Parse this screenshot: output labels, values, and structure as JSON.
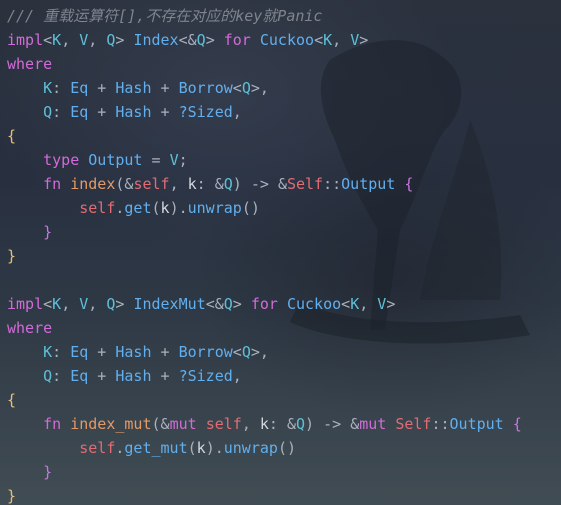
{
  "theme": {
    "background": "#2b313d",
    "colors": {
      "comment": "#7f848e",
      "keyword": "#d26bd8",
      "type": "#61afef",
      "generic": "#5ec0d8",
      "function": "#e39a66",
      "self": "#e06c75",
      "brace_outer": "#e5c07b",
      "brace_inner": "#c678dd"
    }
  },
  "editor": {
    "language": "rust",
    "lines": [
      [
        [
          "/// 重载运算符[],不存在对应的key就Panic",
          "comment"
        ]
      ],
      [
        [
          "impl",
          "kw"
        ],
        [
          "<",
          "op"
        ],
        [
          "K",
          "ty"
        ],
        [
          ", ",
          "punct"
        ],
        [
          "V",
          "ty"
        ],
        [
          ", ",
          "punct"
        ],
        [
          "Q",
          "ty"
        ],
        [
          "> ",
          "op"
        ],
        [
          "Index",
          "type"
        ],
        [
          "<",
          "op"
        ],
        [
          "&",
          "op"
        ],
        [
          "Q",
          "ty"
        ],
        [
          "> ",
          "op"
        ],
        [
          "for ",
          "kw"
        ],
        [
          "Cuckoo",
          "type"
        ],
        [
          "<",
          "op"
        ],
        [
          "K",
          "ty"
        ],
        [
          ", ",
          "punct"
        ],
        [
          "V",
          "ty"
        ],
        [
          ">",
          "op"
        ]
      ],
      [
        [
          "where",
          "kw"
        ]
      ],
      [
        [
          "    ",
          "plain"
        ],
        [
          "K",
          "ty"
        ],
        [
          ": ",
          "punct"
        ],
        [
          "Eq",
          "type"
        ],
        [
          " + ",
          "op"
        ],
        [
          "Hash",
          "type"
        ],
        [
          " + ",
          "op"
        ],
        [
          "Borrow",
          "type"
        ],
        [
          "<",
          "op"
        ],
        [
          "Q",
          "ty"
        ],
        [
          ">",
          "op"
        ],
        [
          ",",
          "punct"
        ]
      ],
      [
        [
          "    ",
          "plain"
        ],
        [
          "Q",
          "ty"
        ],
        [
          ": ",
          "punct"
        ],
        [
          "Eq",
          "type"
        ],
        [
          " + ",
          "op"
        ],
        [
          "Hash",
          "type"
        ],
        [
          " + ",
          "op"
        ],
        [
          "?Sized",
          "type"
        ],
        [
          ",",
          "punct"
        ]
      ],
      [
        [
          "{",
          "brace1"
        ]
      ],
      [
        [
          "    ",
          "plain"
        ],
        [
          "type ",
          "kw"
        ],
        [
          "Output",
          "type"
        ],
        [
          " = ",
          "op"
        ],
        [
          "V",
          "ty"
        ],
        [
          ";",
          "punct"
        ]
      ],
      [
        [
          "    ",
          "plain"
        ],
        [
          "fn ",
          "kw"
        ],
        [
          "index",
          "fn"
        ],
        [
          "(",
          "punct"
        ],
        [
          "&",
          "op"
        ],
        [
          "self",
          "self"
        ],
        [
          ", ",
          "punct"
        ],
        [
          "k",
          "ident"
        ],
        [
          ": ",
          "punct"
        ],
        [
          "&",
          "op"
        ],
        [
          "Q",
          "ty"
        ],
        [
          ") -> ",
          "op"
        ],
        [
          "&",
          "op"
        ],
        [
          "Self",
          "self"
        ],
        [
          "::",
          "punct"
        ],
        [
          "Output",
          "type"
        ],
        [
          " ",
          "plain"
        ],
        [
          "{",
          "brace2"
        ]
      ],
      [
        [
          "        ",
          "plain"
        ],
        [
          "self",
          "self"
        ],
        [
          ".",
          "punct"
        ],
        [
          "get",
          "method"
        ],
        [
          "(",
          "punct"
        ],
        [
          "k",
          "ident"
        ],
        [
          ")",
          "punct"
        ],
        [
          ".",
          "punct"
        ],
        [
          "unwrap",
          "method"
        ],
        [
          "()",
          "punct"
        ]
      ],
      [
        [
          "    ",
          "plain"
        ],
        [
          "}",
          "brace2"
        ]
      ],
      [
        [
          "}",
          "brace1"
        ]
      ],
      [
        [
          "",
          "plain"
        ]
      ],
      [
        [
          "impl",
          "kw"
        ],
        [
          "<",
          "op"
        ],
        [
          "K",
          "ty"
        ],
        [
          ", ",
          "punct"
        ],
        [
          "V",
          "ty"
        ],
        [
          ", ",
          "punct"
        ],
        [
          "Q",
          "ty"
        ],
        [
          "> ",
          "op"
        ],
        [
          "IndexMut",
          "type"
        ],
        [
          "<",
          "op"
        ],
        [
          "&",
          "op"
        ],
        [
          "Q",
          "ty"
        ],
        [
          "> ",
          "op"
        ],
        [
          "for ",
          "kw"
        ],
        [
          "Cuckoo",
          "type"
        ],
        [
          "<",
          "op"
        ],
        [
          "K",
          "ty"
        ],
        [
          ", ",
          "punct"
        ],
        [
          "V",
          "ty"
        ],
        [
          ">",
          "op"
        ]
      ],
      [
        [
          "where",
          "kw"
        ]
      ],
      [
        [
          "    ",
          "plain"
        ],
        [
          "K",
          "ty"
        ],
        [
          ": ",
          "punct"
        ],
        [
          "Eq",
          "type"
        ],
        [
          " + ",
          "op"
        ],
        [
          "Hash",
          "type"
        ],
        [
          " + ",
          "op"
        ],
        [
          "Borrow",
          "type"
        ],
        [
          "<",
          "op"
        ],
        [
          "Q",
          "ty"
        ],
        [
          ">",
          "op"
        ],
        [
          ",",
          "punct"
        ]
      ],
      [
        [
          "    ",
          "plain"
        ],
        [
          "Q",
          "ty"
        ],
        [
          ": ",
          "punct"
        ],
        [
          "Eq",
          "type"
        ],
        [
          " + ",
          "op"
        ],
        [
          "Hash",
          "type"
        ],
        [
          " + ",
          "op"
        ],
        [
          "?Sized",
          "type"
        ],
        [
          ",",
          "punct"
        ]
      ],
      [
        [
          "{",
          "brace1"
        ]
      ],
      [
        [
          "    ",
          "plain"
        ],
        [
          "fn ",
          "kw"
        ],
        [
          "index_mut",
          "fn"
        ],
        [
          "(",
          "punct"
        ],
        [
          "&",
          "op"
        ],
        [
          "mut ",
          "kw"
        ],
        [
          "self",
          "self"
        ],
        [
          ", ",
          "punct"
        ],
        [
          "k",
          "ident"
        ],
        [
          ": ",
          "punct"
        ],
        [
          "&",
          "op"
        ],
        [
          "Q",
          "ty"
        ],
        [
          ") -> ",
          "op"
        ],
        [
          "&",
          "op"
        ],
        [
          "mut ",
          "kw"
        ],
        [
          "Self",
          "self"
        ],
        [
          "::",
          "punct"
        ],
        [
          "Output",
          "type"
        ],
        [
          " ",
          "plain"
        ],
        [
          "{",
          "brace2"
        ]
      ],
      [
        [
          "        ",
          "plain"
        ],
        [
          "self",
          "self"
        ],
        [
          ".",
          "punct"
        ],
        [
          "get_mut",
          "method"
        ],
        [
          "(",
          "punct"
        ],
        [
          "k",
          "ident"
        ],
        [
          ")",
          "punct"
        ],
        [
          ".",
          "punct"
        ],
        [
          "unwrap",
          "method"
        ],
        [
          "()",
          "punct"
        ]
      ],
      [
        [
          "    ",
          "plain"
        ],
        [
          "}",
          "brace2"
        ]
      ],
      [
        [
          "}",
          "brace1"
        ]
      ]
    ]
  }
}
